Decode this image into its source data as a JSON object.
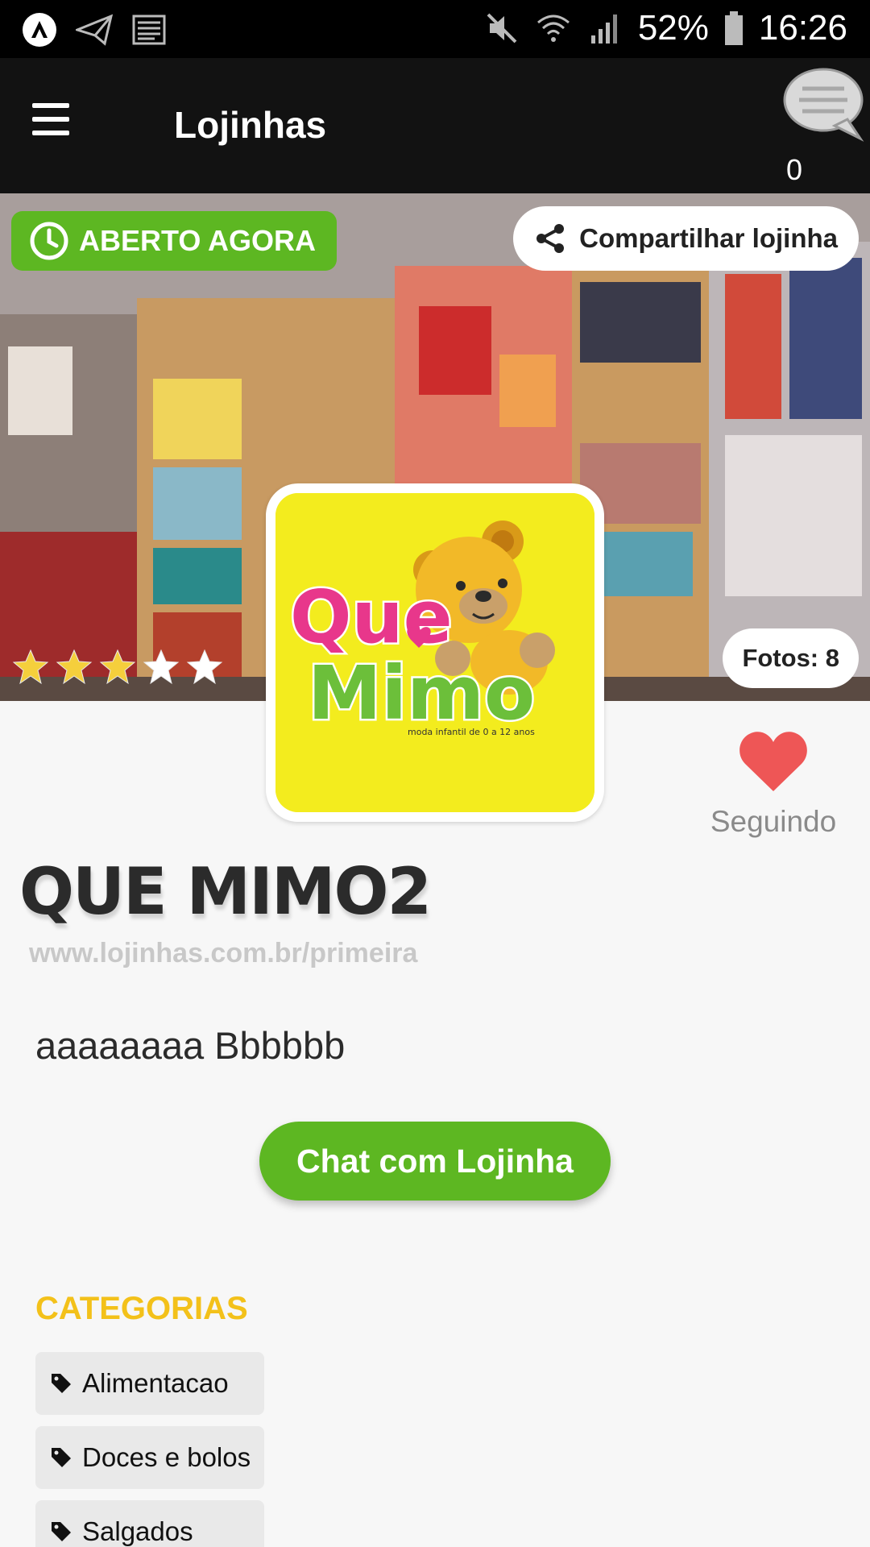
{
  "status_bar": {
    "left_icons": [
      "app-icon",
      "send-icon",
      "news-icon"
    ],
    "battery": "52%",
    "time": "16:26",
    "right_icons": [
      "mute-icon",
      "wifi-icon",
      "signal-icon",
      "battery-icon"
    ]
  },
  "app_bar": {
    "title": "Lojinhas",
    "menu_icon": "hamburger-menu-icon",
    "chat_icon": "chat-bubble-icon",
    "chat_count": "0"
  },
  "hero": {
    "open_badge": "ABERTO AGORA",
    "share_label": "Compartilhar lojinha",
    "photos_label": "Fotos: 8",
    "rating": 3,
    "rating_max": 5
  },
  "logo": {
    "word1": "Que",
    "word2": "Mimo",
    "tagline": "moda infantil de 0 a 12 anos"
  },
  "follow": {
    "label": "Seguindo",
    "icon": "heart-icon"
  },
  "store": {
    "name": "QUE MIMO2",
    "url": "www.lojinhas.com.br/primeira",
    "description": "aaaaaaaa Bbbbbb"
  },
  "chat_button": "Chat com Lojinha",
  "categories": {
    "title": "CATEGORIAS",
    "items": [
      {
        "label": "Alimentacao"
      },
      {
        "label": "Doces e bolos"
      },
      {
        "label": "Salgados"
      }
    ]
  },
  "colors": {
    "accent_green": "#5db722",
    "category_title": "#f3c11a",
    "heart": "#ee5656"
  }
}
